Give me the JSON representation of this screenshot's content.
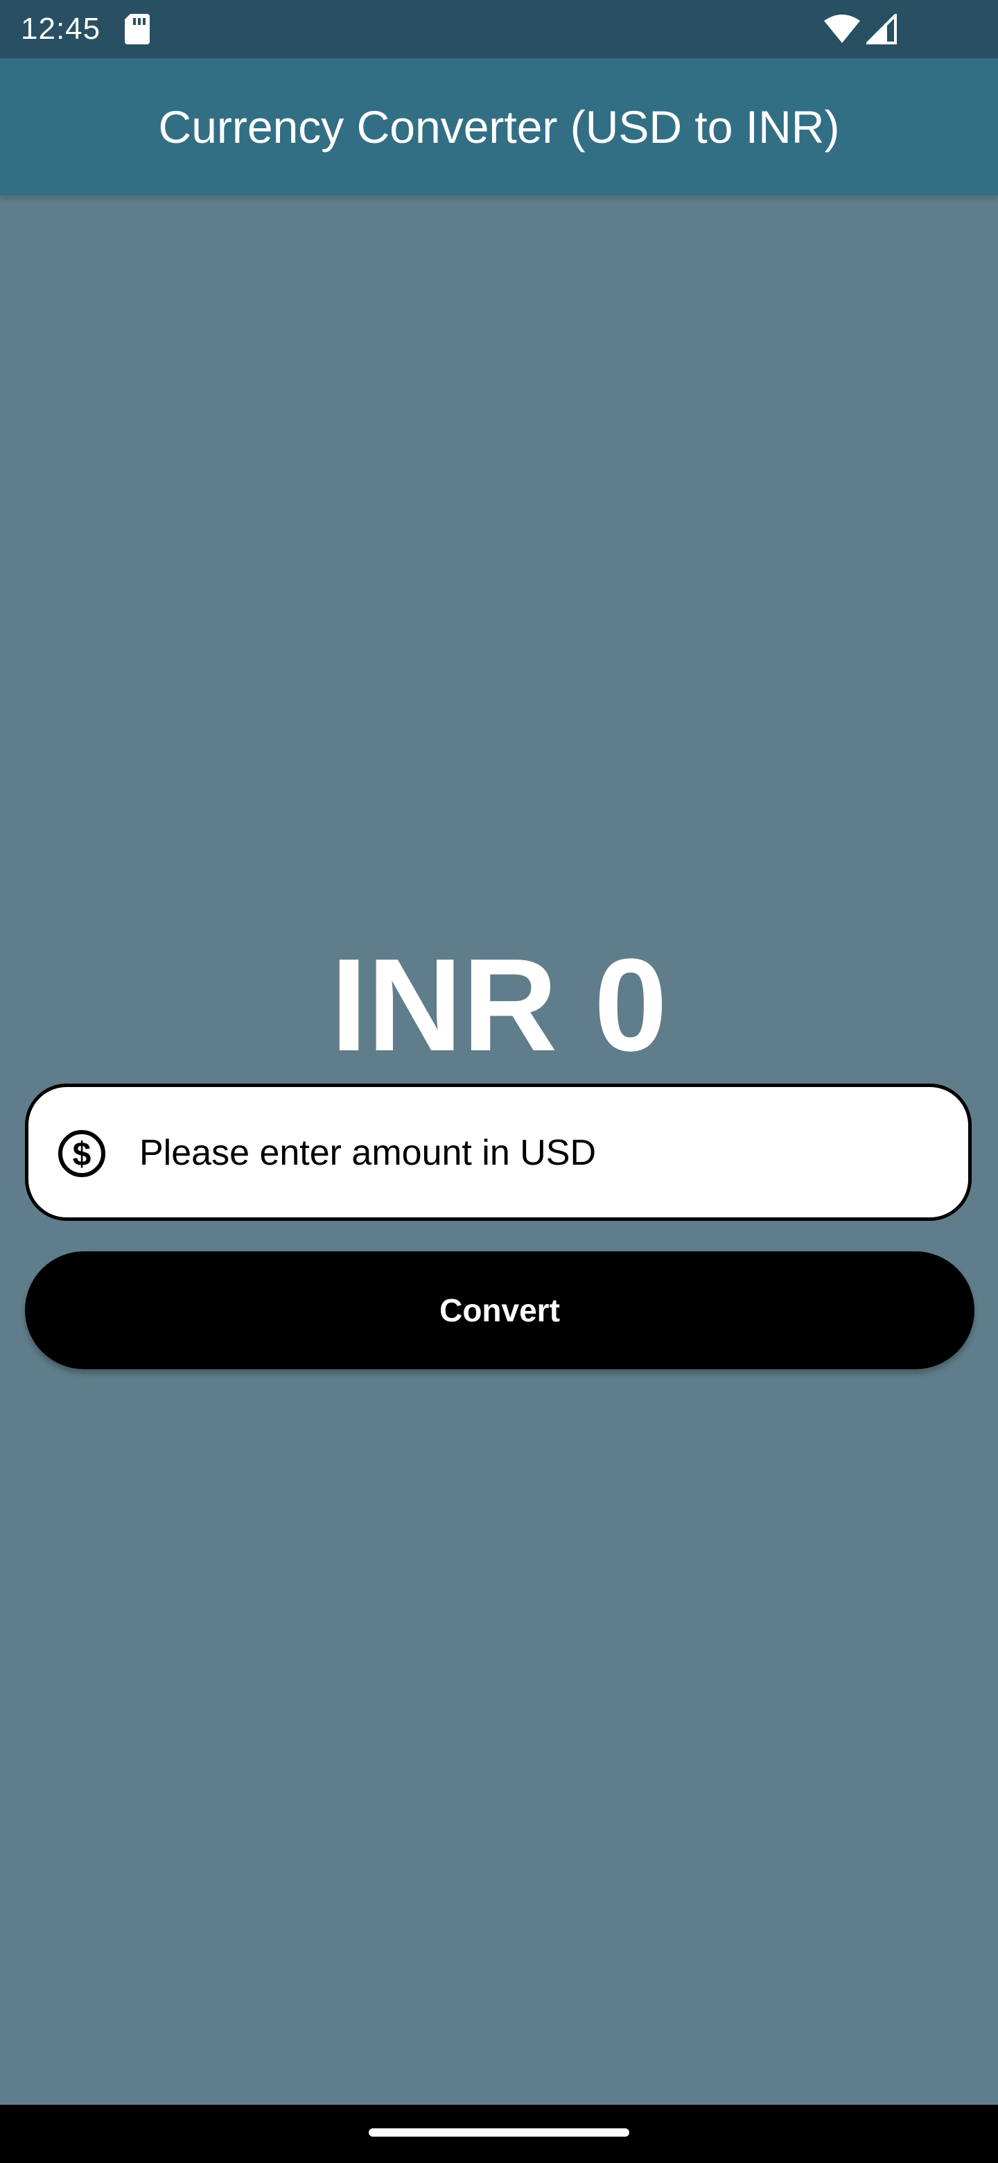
{
  "status_bar": {
    "time": "12:45",
    "icons": [
      "sd-card-icon",
      "wifi-icon",
      "cellular-signal-icon"
    ]
  },
  "app_bar": {
    "title": "Currency Converter (USD to INR)"
  },
  "result": {
    "text": "INR 0"
  },
  "amount_field": {
    "placeholder": "Please enter amount in USD",
    "value": "",
    "icon": "dollar-circle-icon"
  },
  "convert_button": {
    "label": "Convert"
  },
  "colors": {
    "status_bar": "#285062",
    "app_bar": "#326f85",
    "background": "#607d8b",
    "button": "#000000",
    "field": "#ffffff"
  }
}
